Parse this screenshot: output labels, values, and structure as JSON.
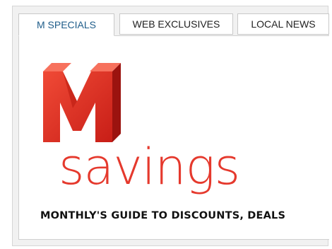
{
  "tabs": [
    {
      "label": "M SPECIALS",
      "active": true
    },
    {
      "label": "WEB EXCLUSIVES",
      "active": false
    },
    {
      "label": "LOCAL NEWS",
      "active": false
    }
  ],
  "promo": {
    "logo_letter": "M",
    "headline": "savings",
    "tagline": "MONTHLY'S GUIDE TO DISCOUNTS, DEALS"
  },
  "colors": {
    "brand_red": "#e5392d",
    "active_tab_text": "#1f5d8a"
  }
}
